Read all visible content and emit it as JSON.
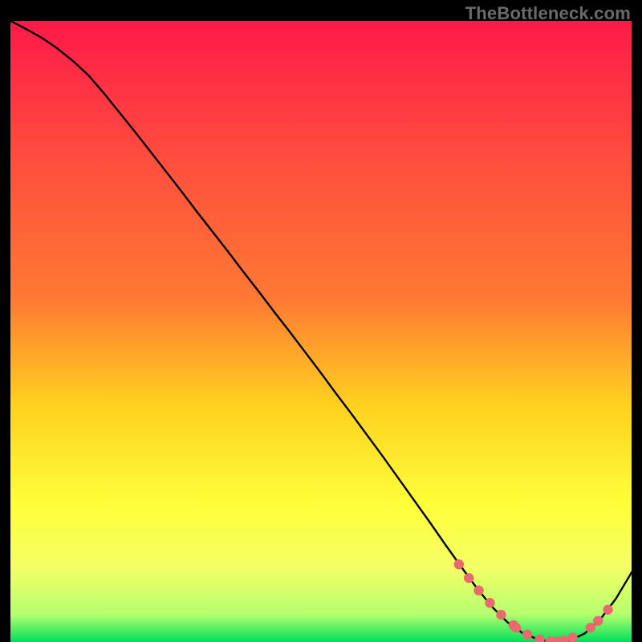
{
  "watermark": "TheBottleneck.com",
  "colors": {
    "curve": "#000000",
    "dots": "#e86a6e",
    "gradient_top": "#ff1a49",
    "gradient_mid1": "#ff7a33",
    "gradient_mid2": "#ffd21f",
    "gradient_mid3": "#ffff3a",
    "gradient_mid4": "#f4ff66",
    "gradient_bottom": "#00e05a"
  },
  "chart_data": {
    "type": "line",
    "title": "",
    "xlabel": "",
    "ylabel": "",
    "xlim": [
      0,
      100
    ],
    "ylim": [
      0,
      100
    ],
    "grid": false,
    "legend": false,
    "x": [
      0.0,
      2.5,
      5.0,
      7.5,
      10.0,
      12.5,
      15.0,
      17.5,
      20.0,
      22.5,
      25.0,
      27.5,
      30.0,
      32.5,
      35.0,
      37.5,
      40.0,
      42.5,
      45.0,
      47.5,
      50.0,
      52.5,
      55.0,
      57.5,
      60.0,
      62.5,
      65.0,
      67.5,
      70.0,
      72.5,
      75.0,
      77.5,
      80.0,
      82.5,
      85.0,
      87.5,
      90.0,
      92.5,
      95.0,
      97.5,
      100.0
    ],
    "y": [
      100.0,
      98.7,
      97.3,
      95.6,
      93.6,
      91.3,
      88.4,
      85.3,
      82.2,
      79.0,
      75.8,
      72.6,
      69.3,
      66.1,
      62.9,
      59.6,
      56.4,
      53.1,
      49.9,
      46.6,
      43.3,
      39.9,
      36.6,
      33.2,
      29.8,
      26.3,
      22.8,
      19.3,
      15.7,
      12.2,
      8.8,
      5.7,
      3.2,
      1.4,
      0.4,
      0.0,
      0.2,
      1.4,
      3.7,
      7.0,
      11.2
    ],
    "dots": [
      {
        "x": 72.2,
        "y": 12.5
      },
      {
        "x": 73.8,
        "y": 10.3
      },
      {
        "x": 75.4,
        "y": 8.3
      },
      {
        "x": 77.2,
        "y": 6.3
      },
      {
        "x": 79.0,
        "y": 4.4
      },
      {
        "x": 81.0,
        "y": 2.7
      },
      {
        "x": 81.4,
        "y": 2.3
      },
      {
        "x": 83.2,
        "y": 1.2
      },
      {
        "x": 85.2,
        "y": 0.4
      },
      {
        "x": 86.9,
        "y": 0.1
      },
      {
        "x": 88.1,
        "y": 0.1
      },
      {
        "x": 89.1,
        "y": 0.2
      },
      {
        "x": 90.5,
        "y": 0.7
      },
      {
        "x": 93.4,
        "y": 2.3
      },
      {
        "x": 94.6,
        "y": 3.4
      },
      {
        "x": 96.2,
        "y": 5.2
      }
    ]
  }
}
